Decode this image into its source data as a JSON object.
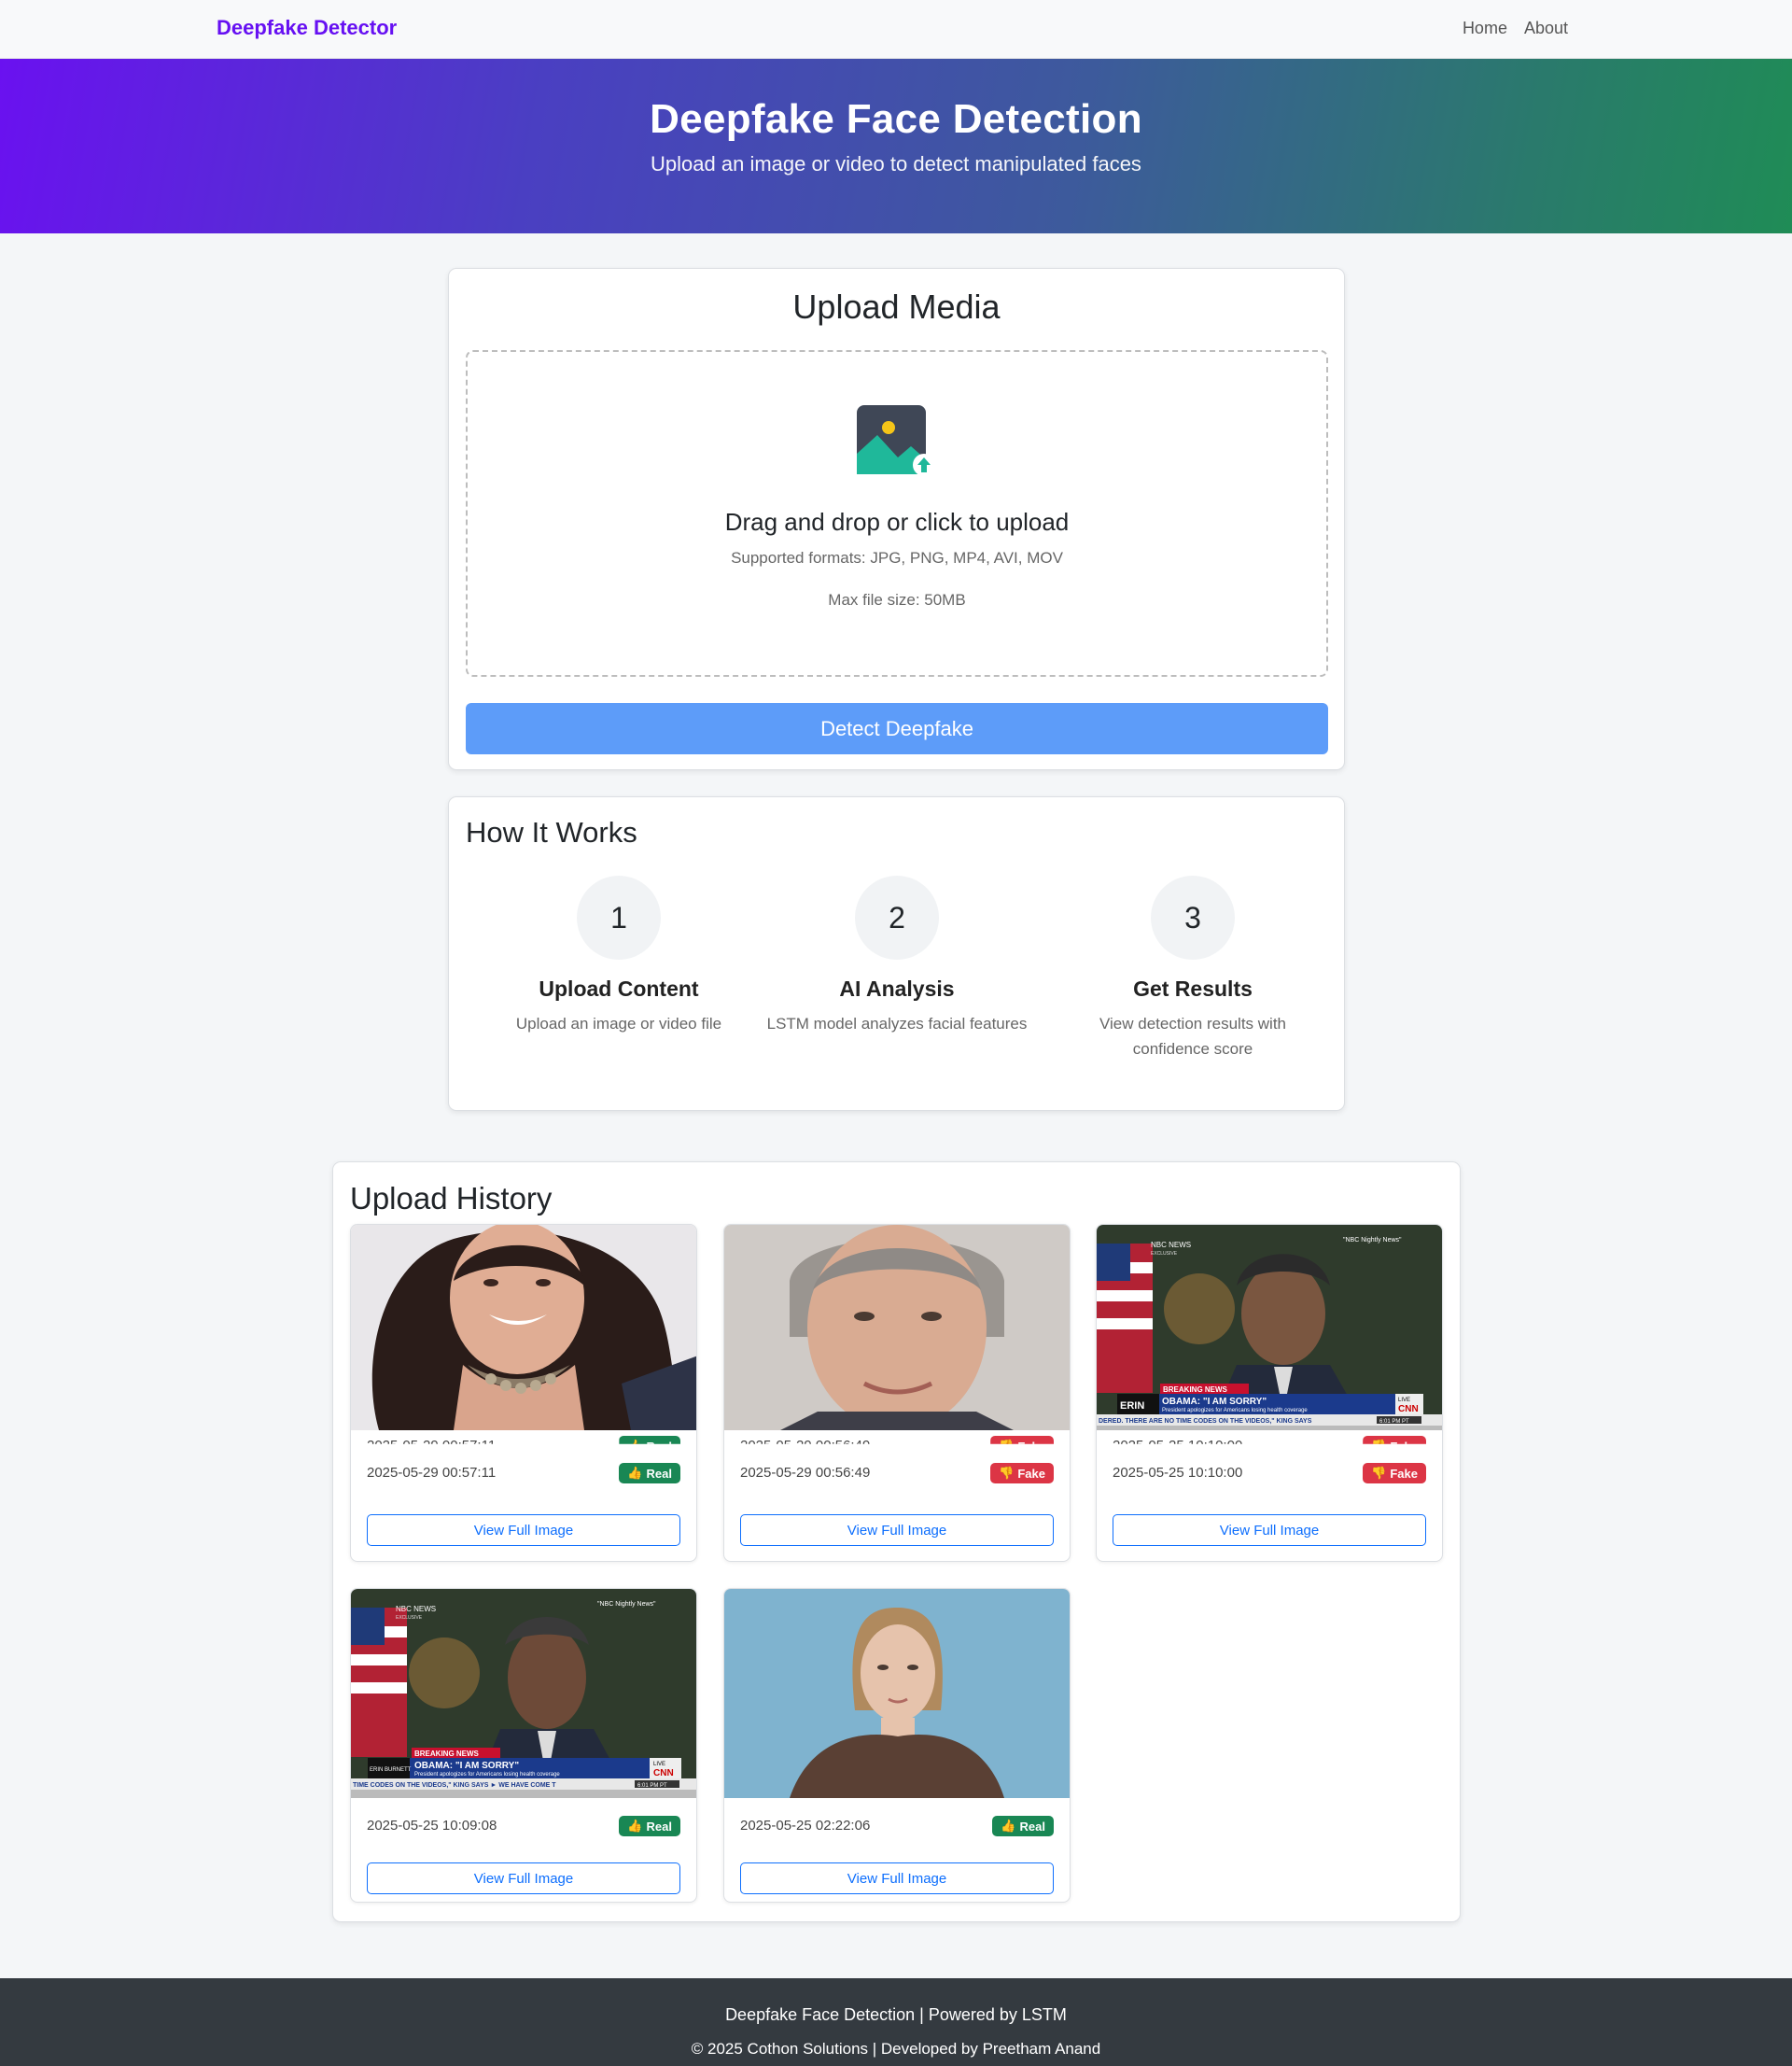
{
  "navbar": {
    "brand": "Deepfake Detector",
    "links": [
      "Home",
      "About"
    ]
  },
  "hero": {
    "title": "Deepfake Face Detection",
    "subtitle": "Upload an image or video to detect manipulated faces"
  },
  "upload": {
    "title": "Upload Media",
    "drop_title": "Drag and drop or click to upload",
    "formats": "Supported formats: JPG, PNG, MP4, AVI, MOV",
    "max_size": "Max file size: 50MB",
    "detect_button": "Detect Deepfake",
    "icon": "image-upload-icon"
  },
  "how": {
    "title": "How It Works",
    "steps": [
      {
        "number": "1",
        "title": "Upload Content",
        "desc": "Upload an image or video file"
      },
      {
        "number": "2",
        "title": "AI Analysis",
        "desc": "LSTM model analyzes facial features"
      },
      {
        "number": "3",
        "title": "Get Results",
        "desc": "View detection results with confidence score"
      }
    ]
  },
  "history": {
    "title": "Upload History",
    "items": [
      {
        "timestamp": "2025-05-29 00:57:11",
        "result": "Real",
        "button": "View Full Image",
        "thumb": "woman-smiling-portrait"
      },
      {
        "timestamp": "2025-05-29 00:56:49",
        "result": "Fake",
        "button": "View Full Image",
        "thumb": "older-man-portrait"
      },
      {
        "timestamp": "2025-05-25 10:10:00",
        "result": "Fake",
        "button": "View Full Image",
        "thumb": "news-broadcast-still"
      },
      {
        "timestamp": "2025-05-25 10:09:08",
        "result": "Real",
        "button": "View Full Image",
        "thumb": "news-broadcast-still"
      },
      {
        "timestamp": "2025-05-25 02:22:06",
        "result": "Real",
        "button": "View Full Image",
        "thumb": "woman-blue-background"
      }
    ],
    "news": {
      "network": "NBC NEWS",
      "exclusive": "EXCLUSIVE",
      "show": "\"NBC Nightly News\"",
      "breaking": "BREAKING NEWS",
      "headline": "OBAMA: \"I AM SORRY\"",
      "subhead": "President apologizes for Americans losing health coverage",
      "ticker": "DERED. THERE ARE NO TIME CODES ON THE VIDEOS,\" KING SAYS",
      "ticker2": "TIME CODES ON THE VIDEOS,\" KING SAYS ► WE HAVE COME T",
      "anchor": "ERIN",
      "anchor2": "ERIN BURNETT",
      "live": "LIVE",
      "channel": "CNN",
      "time": "6:01 PM PT"
    }
  },
  "footer": {
    "line1": "Deepfake Face Detection | Powered by LSTM",
    "line2": "© 2025 Cothon Solutions | Developed by Preetham Anand"
  },
  "colors": {
    "brand": "#6610f2",
    "primary": "#0d6efd",
    "detect_button": "#5d9cf9",
    "real": "#198754",
    "fake": "#dc3545",
    "footer": "#343a40"
  }
}
